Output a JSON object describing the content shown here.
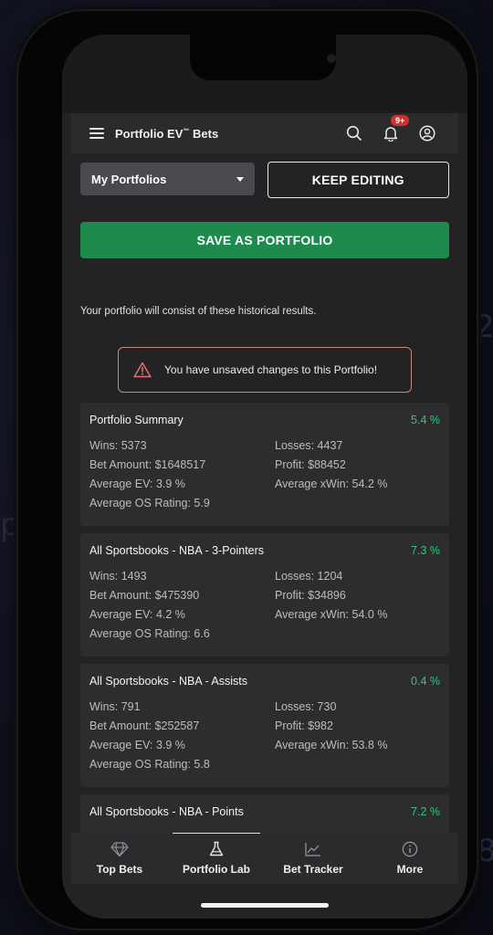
{
  "app": {
    "title": "Portfolio EV",
    "title_tm": "™",
    "title_suffix": " Bets",
    "notification_count": "9+"
  },
  "controls": {
    "portfolio_select": "My Portfolios",
    "keep_editing": "KEEP EDITING",
    "save_as_portfolio": "SAVE AS PORTFOLIO"
  },
  "info_text": "Your portfolio will consist of these historical results.",
  "warning_text": "You have unsaved changes to this Portfolio!",
  "cards": [
    {
      "title": "Portfolio Summary",
      "pct": "5.4 %",
      "wins": "Wins: 5373",
      "losses": "Losses: 4437",
      "bet_amount": "Bet Amount: $1648517",
      "profit": "Profit: $88452",
      "avg_ev": "Average EV: 3.9 %",
      "avg_xwin": "Average xWin: 54.2 %",
      "avg_os": "Average OS Rating: 5.9"
    },
    {
      "title": "All Sportsbooks - NBA - 3-Pointers",
      "pct": "7.3 %",
      "wins": "Wins: 1493",
      "losses": "Losses: 1204",
      "bet_amount": "Bet Amount: $475390",
      "profit": "Profit: $34896",
      "avg_ev": "Average EV: 4.2 %",
      "avg_xwin": "Average xWin: 54.0 %",
      "avg_os": "Average OS Rating: 6.6"
    },
    {
      "title": "All Sportsbooks - NBA - Assists",
      "pct": "0.4 %",
      "wins": "Wins: 791",
      "losses": "Losses: 730",
      "bet_amount": "Bet Amount: $252587",
      "profit": "Profit: $982",
      "avg_ev": "Average EV: 3.9 %",
      "avg_xwin": "Average xWin: 53.8 %",
      "avg_os": "Average OS Rating: 5.8"
    },
    {
      "title": "All Sportsbooks - NBA - Points",
      "pct": "7.2 %"
    }
  ],
  "tabs": [
    {
      "label": "Top Bets",
      "icon": "diamond-icon"
    },
    {
      "label": "Portfolio Lab",
      "icon": "flask-icon"
    },
    {
      "label": "Bet Tracker",
      "icon": "chart-icon"
    },
    {
      "label": "More",
      "icon": "info-icon"
    }
  ],
  "colors": {
    "accent_green": "#1e8a4c",
    "positive_pct": "#37c37a",
    "badge_red": "#d32f2f"
  }
}
